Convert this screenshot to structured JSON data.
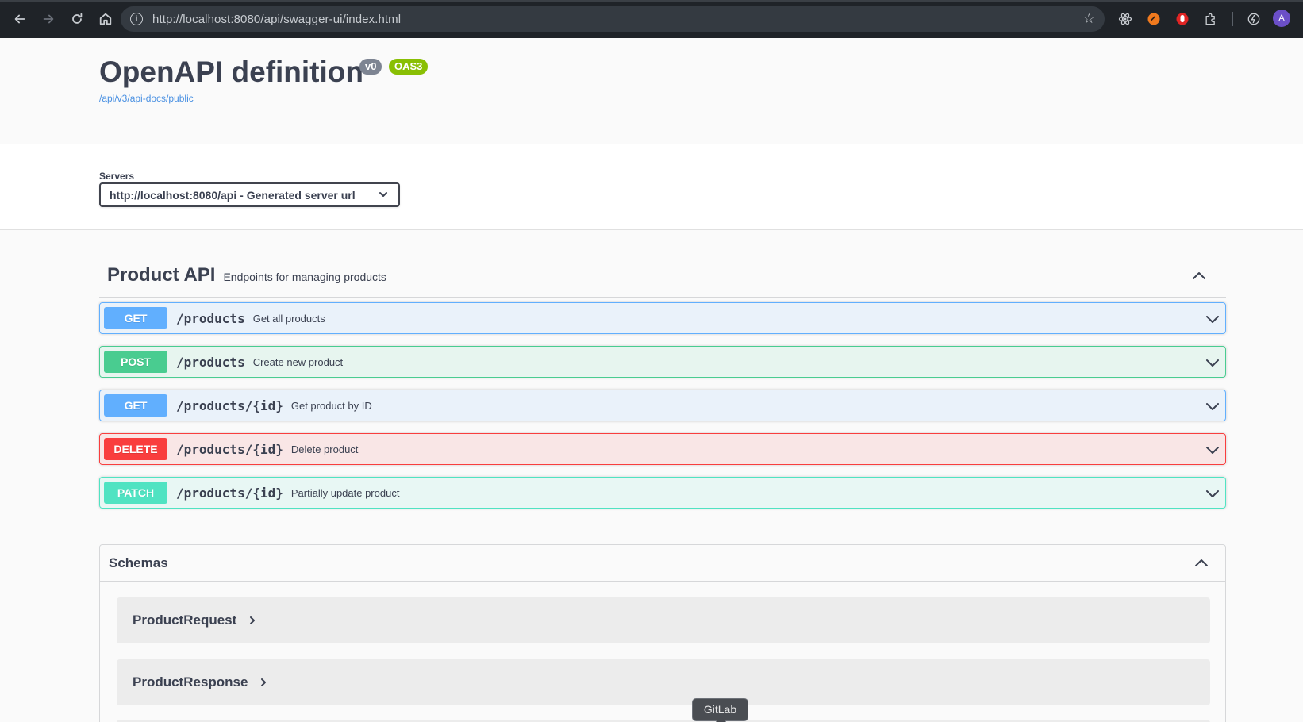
{
  "browser": {
    "url": "http://localhost:8080/api/swagger-ui/index.html",
    "profile_initial": "A",
    "tooltip": "GitLab"
  },
  "info": {
    "title": "OpenAPI definition",
    "version_badge": "v0",
    "oas_badge": "OAS3",
    "spec_link": "/api/v3/api-docs/public"
  },
  "servers": {
    "label": "Servers",
    "selected": "http://localhost:8080/api - Generated server url"
  },
  "tag": {
    "name": "Product API",
    "description": "Endpoints for managing products"
  },
  "operations": [
    {
      "method": "GET",
      "path": "/products",
      "summary": "Get all products"
    },
    {
      "method": "POST",
      "path": "/products",
      "summary": "Create new product"
    },
    {
      "method": "GET",
      "path": "/products/{id}",
      "summary": "Get product by ID"
    },
    {
      "method": "DELETE",
      "path": "/products/{id}",
      "summary": "Delete product"
    },
    {
      "method": "PATCH",
      "path": "/products/{id}",
      "summary": "Partially update product"
    }
  ],
  "schemas": {
    "title": "Schemas",
    "models": [
      "ProductRequest",
      "ProductResponse"
    ]
  },
  "colors": {
    "get": "#61affe",
    "post": "#49cc90",
    "delete": "#f93e3e",
    "patch": "#50e3c2",
    "oas_badge": "#89bf04",
    "link": "#4990e2"
  }
}
